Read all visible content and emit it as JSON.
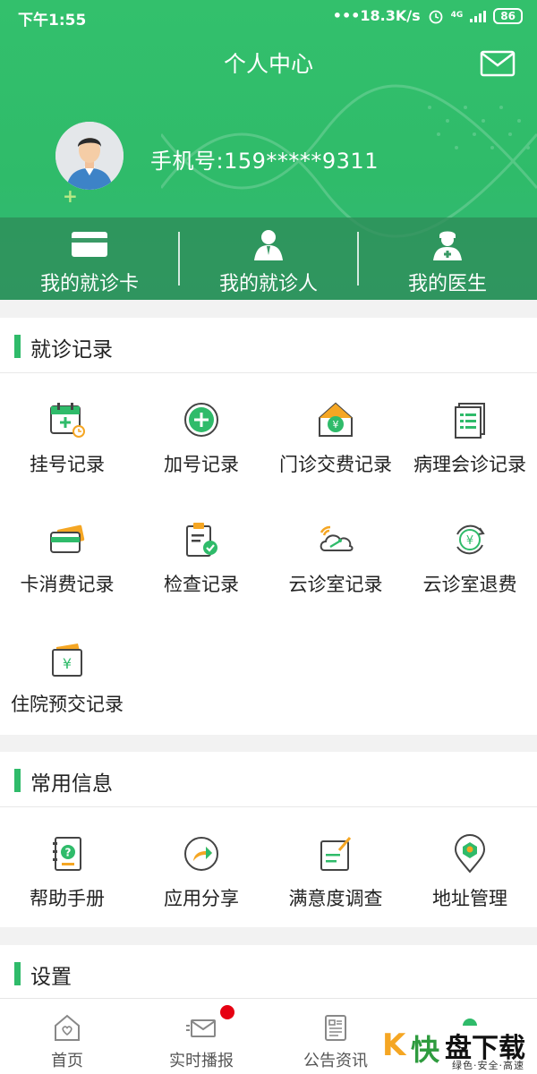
{
  "status": {
    "time": "下午1:55",
    "network_speed": "•••18.3K/s",
    "network_type": "4G",
    "battery": "86"
  },
  "header": {
    "title": "个人中心",
    "mail_icon": "mail-icon",
    "phone": "手机号:159*****9311"
  },
  "quick_links": [
    {
      "label": "我的就诊卡",
      "icon": "card-icon"
    },
    {
      "label": "我的就诊人",
      "icon": "patient-icon"
    },
    {
      "label": "我的医生",
      "icon": "doctor-icon"
    }
  ],
  "records": {
    "title": "就诊记录",
    "items": [
      {
        "label": "挂号记录",
        "icon": "calendar-add-icon"
      },
      {
        "label": "加号记录",
        "icon": "plus-circle-icon"
      },
      {
        "label": "门诊交费记录",
        "icon": "house-yuan-icon"
      },
      {
        "label": "病理会诊记录",
        "icon": "document-list-icon"
      },
      {
        "label": "卡消费记录",
        "icon": "card-wallet-icon"
      },
      {
        "label": "检查记录",
        "icon": "clipboard-check-icon"
      },
      {
        "label": "云诊室记录",
        "icon": "cloud-stethoscope-icon"
      },
      {
        "label": "云诊室退费",
        "icon": "refund-yuan-icon"
      },
      {
        "label": "住院预交记录",
        "icon": "yuan-wallet-icon"
      }
    ]
  },
  "info": {
    "title": "常用信息",
    "items": [
      {
        "label": "帮助手册",
        "icon": "help-book-icon"
      },
      {
        "label": "应用分享",
        "icon": "share-icon"
      },
      {
        "label": "满意度调查",
        "icon": "survey-icon"
      },
      {
        "label": "地址管理",
        "icon": "location-icon"
      }
    ]
  },
  "settings": {
    "title": "设置"
  },
  "tabs": [
    {
      "label": "首页",
      "icon": "home-icon"
    },
    {
      "label": "实时播报",
      "icon": "broadcast-icon"
    },
    {
      "label": "公告资讯",
      "icon": "news-icon"
    }
  ],
  "watermark": {
    "k": "K",
    "kuai": "快",
    "main": "盘下载",
    "sub": "绿色·安全·高速"
  },
  "colors": {
    "primary_green": "#2fbb6a",
    "badge_red": "#e60012",
    "accent_orange": "#f5a623"
  }
}
